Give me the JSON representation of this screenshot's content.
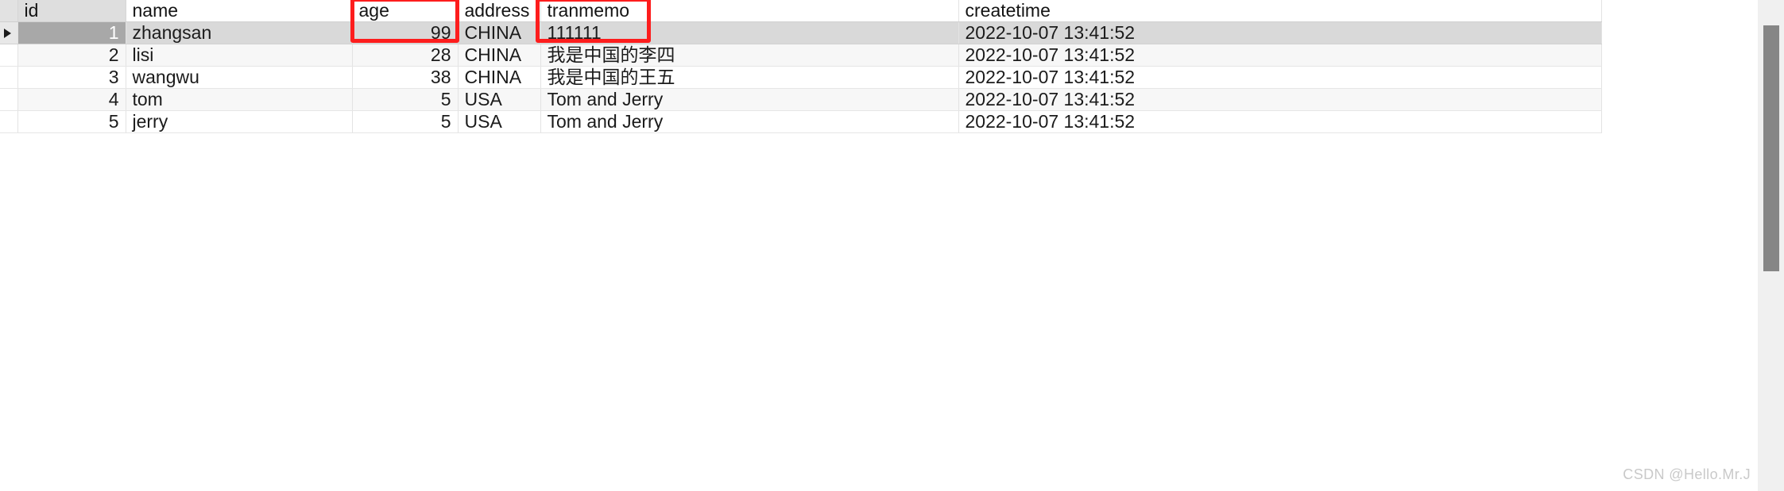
{
  "grid": {
    "columns": [
      {
        "key": "gutter",
        "label": "",
        "align": "left"
      },
      {
        "key": "id",
        "label": "id",
        "align": "right"
      },
      {
        "key": "name",
        "label": "name",
        "align": "left"
      },
      {
        "key": "age",
        "label": "age",
        "align": "right"
      },
      {
        "key": "address",
        "label": "address",
        "align": "left"
      },
      {
        "key": "tranmemo",
        "label": "tranmemo",
        "align": "left"
      },
      {
        "key": "createtime",
        "label": "createtime",
        "align": "left"
      }
    ],
    "headers": {
      "id": "id",
      "name": "name",
      "age": "age",
      "address": "address",
      "tranmemo": "tranmemo",
      "createtime": "createtime"
    },
    "rows": [
      {
        "id": "1",
        "name": "zhangsan",
        "age": "99",
        "address": "CHINA",
        "tranmemo": "111111",
        "createtime": "2022-10-07 13:41:52",
        "selected": true
      },
      {
        "id": "2",
        "name": "lisi",
        "age": "28",
        "address": "CHINA",
        "tranmemo": "我是中国的李四",
        "createtime": "2022-10-07 13:41:52",
        "selected": false
      },
      {
        "id": "3",
        "name": "wangwu",
        "age": "38",
        "address": "CHINA",
        "tranmemo": "我是中国的王五",
        "createtime": "2022-10-07 13:41:52",
        "selected": false
      },
      {
        "id": "4",
        "name": "tom",
        "age": "5",
        "address": "USA",
        "tranmemo": "Tom and Jerry",
        "createtime": "2022-10-07 13:41:52",
        "selected": false
      },
      {
        "id": "5",
        "name": "jerry",
        "age": "5",
        "address": "USA",
        "tranmemo": "Tom and Jerry",
        "createtime": "2022-10-07 13:41:52",
        "selected": false
      }
    ],
    "row_marker_icon": "play-triangle-icon",
    "selected_row_id": "1"
  },
  "annotations": [
    {
      "id": "anno-age",
      "target_column": "age",
      "color": "#fd1d1d"
    },
    {
      "id": "anno-tranmemo",
      "target_column": "tranmemo",
      "color": "#fd1d1d"
    }
  ],
  "scrollbar": {
    "orientation": "vertical",
    "thumb_icon": "scrollbar-thumb"
  },
  "watermark": {
    "text": "CSDN @Hello.Mr.J"
  },
  "colors": {
    "selection_row": "#d9d9d9",
    "selection_id_cell": "#a8a8a8",
    "header_id": "#dedede",
    "alt_row": "#f7f7f7",
    "annotation_red": "#fd1d1d",
    "scrollbar_track": "#f0f0f0",
    "scrollbar_thumb": "#868686",
    "watermark": "#c9c9c9"
  }
}
